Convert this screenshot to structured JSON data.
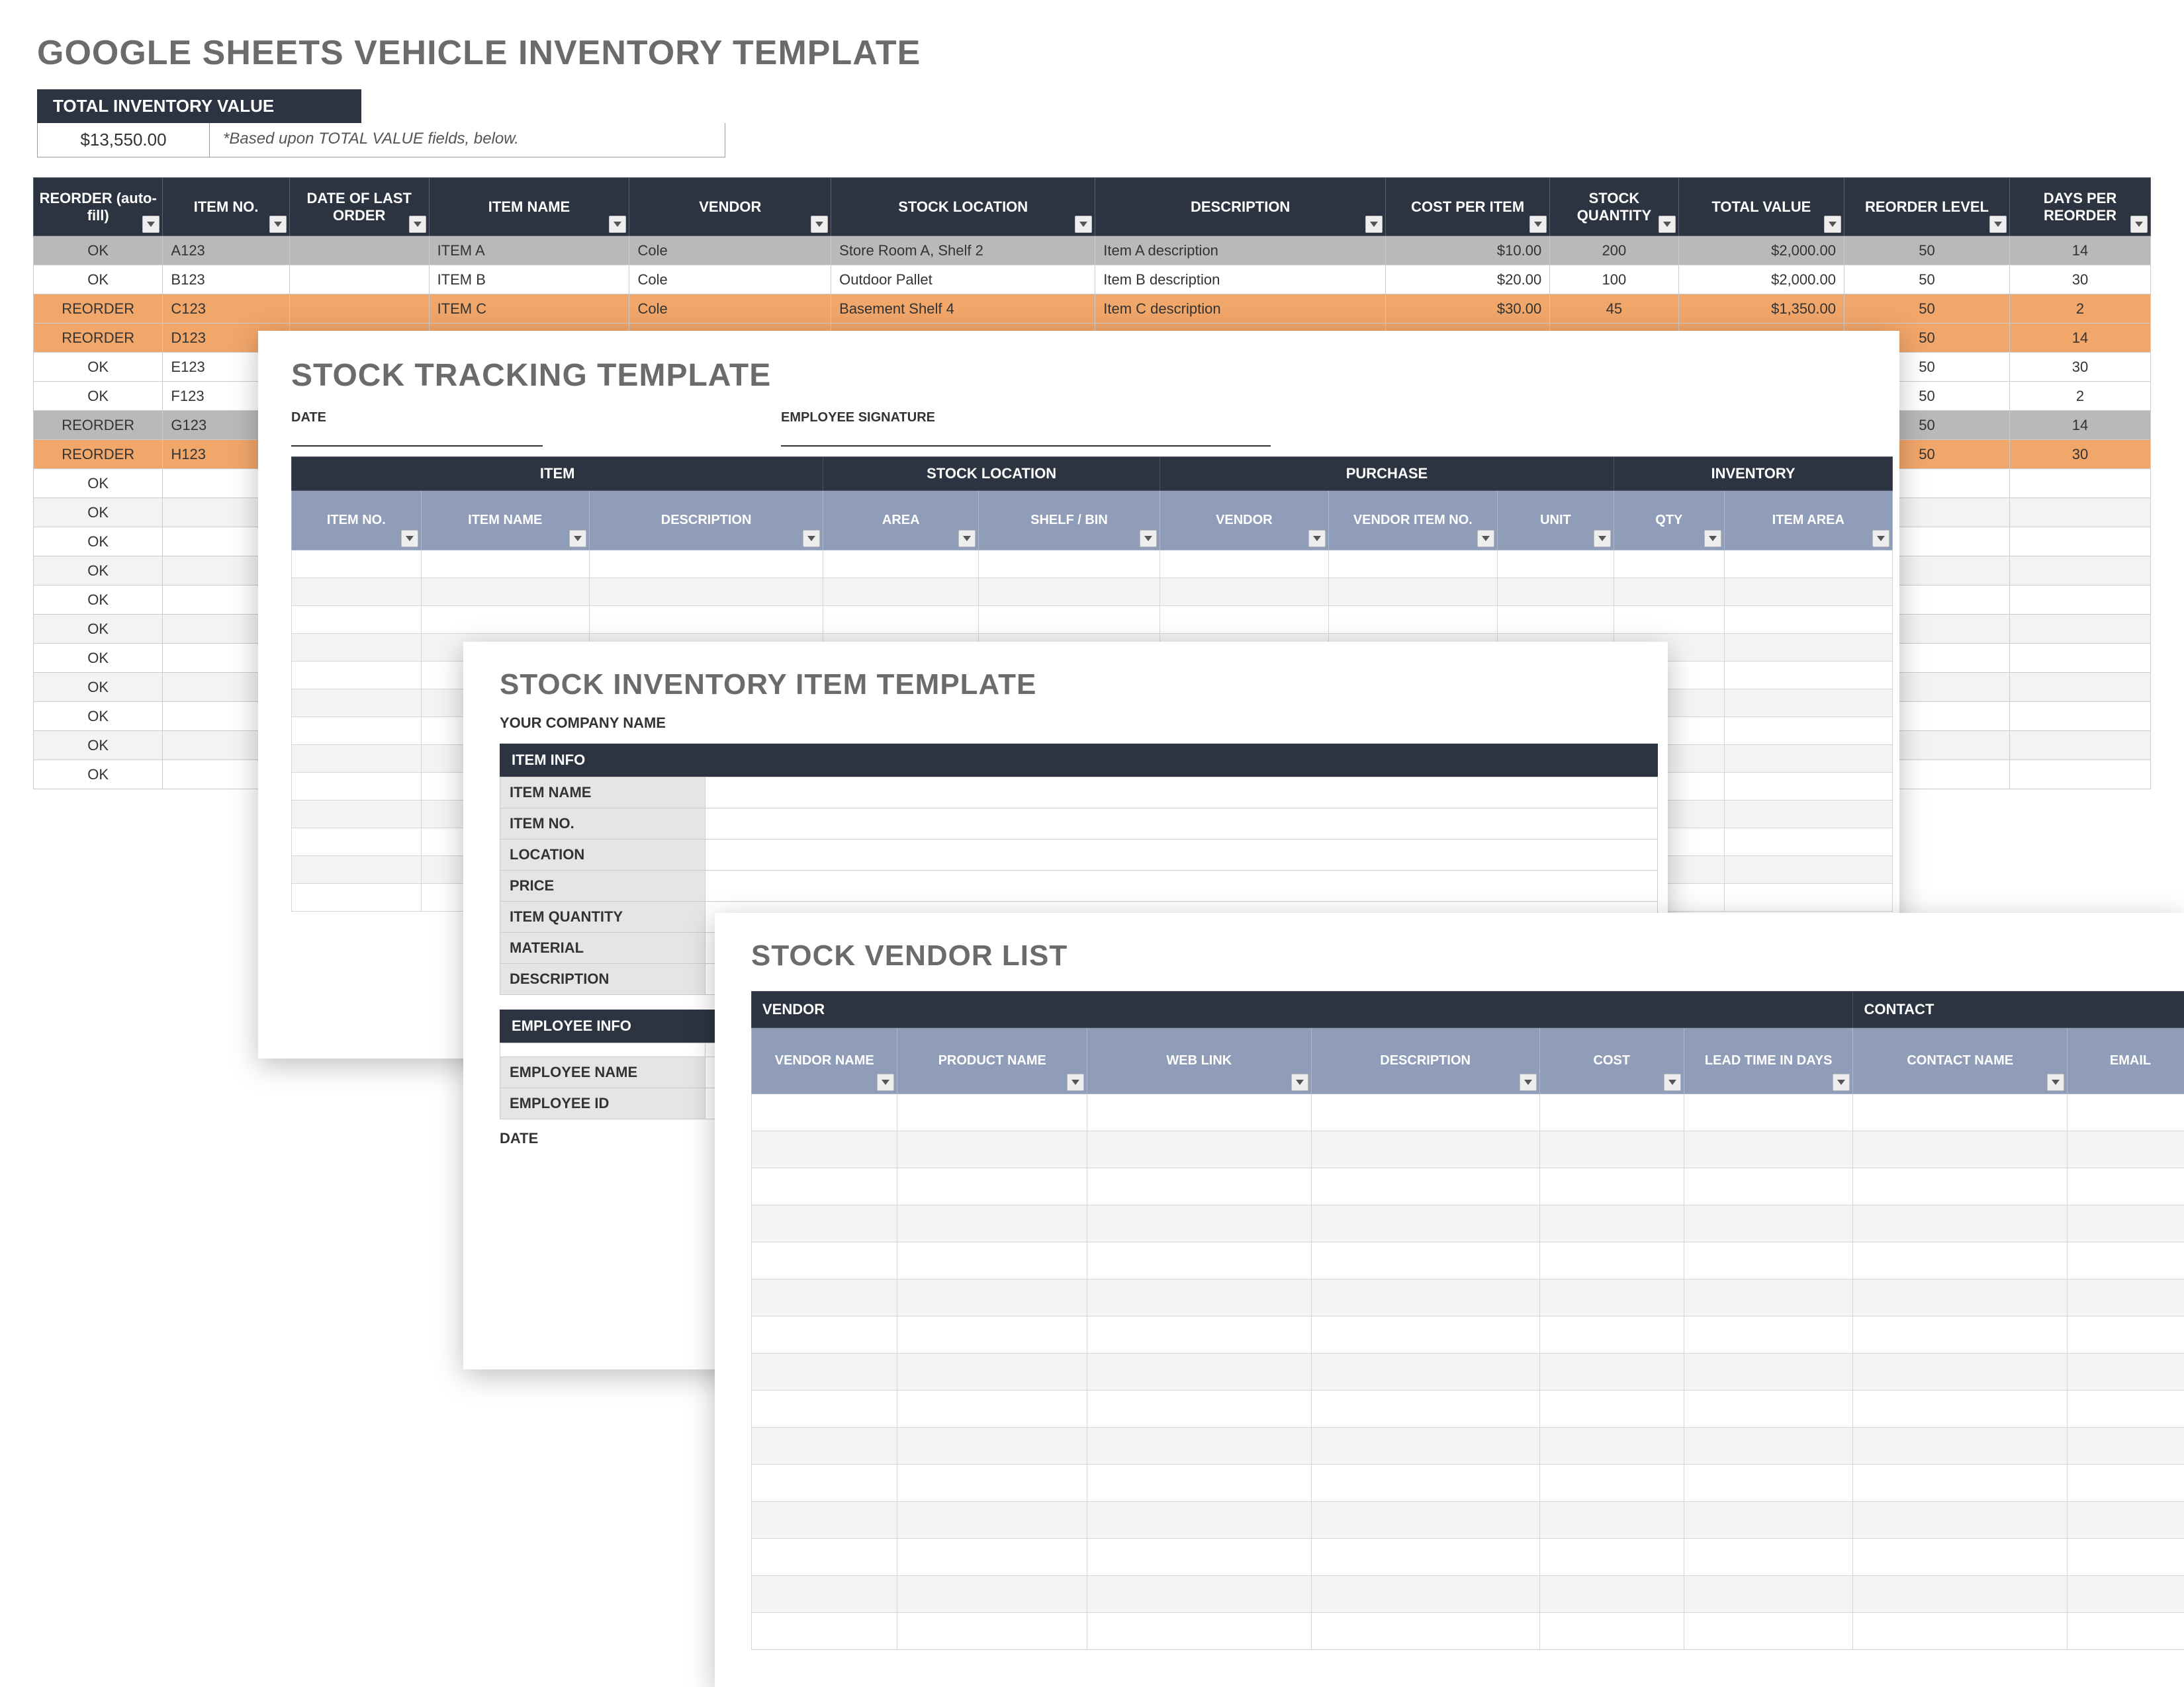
{
  "vehicle": {
    "title": "GOOGLE SHEETS VEHICLE INVENTORY TEMPLATE",
    "total_label": "TOTAL INVENTORY VALUE",
    "total_value": "$13,550.00",
    "total_note": "*Based upon TOTAL VALUE fields, below.",
    "cols": {
      "reorder": "REORDER (auto-fill)",
      "item_no": "ITEM NO.",
      "date": "DATE OF LAST ORDER",
      "name": "ITEM NAME",
      "vendor": "VENDOR",
      "loc": "STOCK LOCATION",
      "desc": "DESCRIPTION",
      "cost": "COST PER ITEM",
      "qty": "STOCK QUANTITY",
      "total": "TOTAL VALUE",
      "rlvl": "REORDER LEVEL",
      "days": "DAYS PER REORDER"
    },
    "rows": [
      {
        "class": "row-grey",
        "reorder": "OK",
        "item": "A123",
        "date": "",
        "name": "ITEM A",
        "vendor": "Cole",
        "loc": "Store Room A, Shelf 2",
        "desc": "Item A description",
        "cost": "$10.00",
        "qty": "200",
        "total": "$2,000.00",
        "rlvl": "50",
        "days": "14"
      },
      {
        "class": "row-ok",
        "reorder": "OK",
        "item": "B123",
        "date": "",
        "name": "ITEM B",
        "vendor": "Cole",
        "loc": "Outdoor Pallet",
        "desc": "Item B description",
        "cost": "$20.00",
        "qty": "100",
        "total": "$2,000.00",
        "rlvl": "50",
        "days": "30"
      },
      {
        "class": "row-orange",
        "reorder": "REORDER",
        "item": "C123",
        "date": "",
        "name": "ITEM C",
        "vendor": "Cole",
        "loc": "Basement Shelf 4",
        "desc": "Item C description",
        "cost": "$30.00",
        "qty": "45",
        "total": "$1,350.00",
        "rlvl": "50",
        "days": "2"
      },
      {
        "class": "row-orange",
        "reorder": "REORDER",
        "item": "D123",
        "date": "",
        "name": "",
        "vendor": "",
        "loc": "",
        "desc": "",
        "cost": "",
        "qty": "",
        "total": "",
        "rlvl": "50",
        "days": "14"
      },
      {
        "class": "row-ok",
        "reorder": "OK",
        "item": "E123",
        "date": "",
        "name": "",
        "vendor": "",
        "loc": "",
        "desc": "",
        "cost": "",
        "qty": "",
        "total": "",
        "rlvl": "50",
        "days": "30"
      },
      {
        "class": "row-ok",
        "reorder": "OK",
        "item": "F123",
        "date": "",
        "name": "",
        "vendor": "",
        "loc": "",
        "desc": "",
        "cost": "",
        "qty": "",
        "total": "",
        "rlvl": "50",
        "days": "2"
      },
      {
        "class": "row-grey",
        "reorder": "REORDER",
        "item": "G123",
        "date": "",
        "name": "",
        "vendor": "",
        "loc": "",
        "desc": "",
        "cost": "",
        "qty": "",
        "total": "",
        "rlvl": "50",
        "days": "14"
      },
      {
        "class": "row-orange",
        "reorder": "REORDER",
        "item": "H123",
        "date": "",
        "name": "",
        "vendor": "",
        "loc": "",
        "desc": "",
        "cost": "",
        "qty": "",
        "total": "",
        "rlvl": "50",
        "days": "30"
      }
    ],
    "ok_label": "OK",
    "ok_tail_count": 11
  },
  "tracking": {
    "title": "STOCK TRACKING TEMPLATE",
    "date_label": "DATE",
    "sig_label": "EMPLOYEE SIGNATURE",
    "groups": {
      "item": "ITEM",
      "loc": "STOCK LOCATION",
      "purchase": "PURCHASE",
      "inventory": "INVENTORY"
    },
    "cols": {
      "item_no": "ITEM NO.",
      "name": "ITEM NAME",
      "desc": "DESCRIPTION",
      "area": "AREA",
      "shelf": "SHELF / BIN",
      "vendor": "VENDOR",
      "vno": "VENDOR ITEM NO.",
      "unit": "UNIT",
      "qty": "QTY",
      "iarea": "ITEM AREA"
    },
    "blank_rows": 13
  },
  "item": {
    "title": "STOCK INVENTORY ITEM TEMPLATE",
    "company_label": "YOUR COMPANY NAME",
    "item_info": "ITEM INFO",
    "keys": {
      "name": "ITEM NAME",
      "no": "ITEM NO.",
      "loc": "LOCATION",
      "price": "PRICE",
      "qty": "ITEM QUANTITY",
      "mat": "MATERIAL",
      "desc": "DESCRIPTION"
    },
    "employee_info": "EMPLOYEE INFO",
    "emp_keys": {
      "name": "EMPLOYEE NAME",
      "id": "EMPLOYEE ID"
    },
    "date_label": "DATE"
  },
  "vendor": {
    "title": "STOCK VENDOR LIST",
    "groups": {
      "vendor": "VENDOR",
      "contact": "CONTACT"
    },
    "cols": {
      "vname": "VENDOR NAME",
      "pname": "PRODUCT NAME",
      "web": "WEB LINK",
      "desc": "DESCRIPTION",
      "cost": "COST",
      "lead": "LEAD TIME IN DAYS",
      "cname": "CONTACT NAME",
      "email": "EMAIL"
    },
    "blank_rows": 15
  }
}
